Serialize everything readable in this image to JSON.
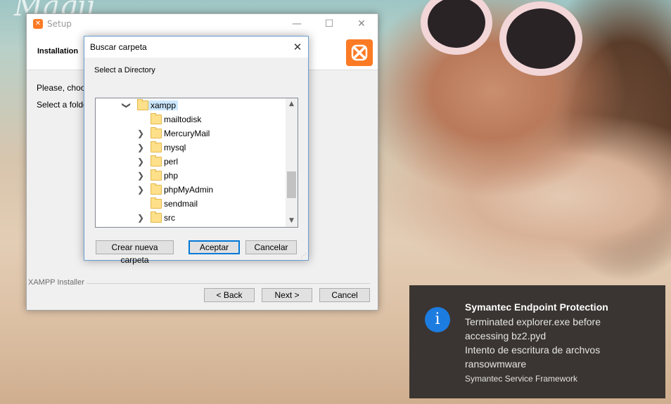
{
  "desktop": {
    "wallpaper_text": "Magii"
  },
  "setup": {
    "title": "Setup",
    "header_title": "Installation",
    "line1": "Please, choose",
    "line2": "Select a folder",
    "installer_label": "XAMPP Installer",
    "back_label": "< Back",
    "next_label": "Next >",
    "cancel_label": "Cancel",
    "controls": {
      "minimize": "—",
      "maximize": "☐",
      "close": "✕"
    }
  },
  "browse": {
    "title": "Buscar carpeta",
    "close": "✕",
    "prompt": "Select a Directory",
    "tree": [
      {
        "label": "xampp",
        "expanded": true,
        "selected": true
      },
      {
        "label": "mailtodisk",
        "has_children": false
      },
      {
        "label": "MercuryMail",
        "has_children": true
      },
      {
        "label": "mysql",
        "has_children": true
      },
      {
        "label": "perl",
        "has_children": true
      },
      {
        "label": "php",
        "has_children": true
      },
      {
        "label": "phpMyAdmin",
        "has_children": true
      },
      {
        "label": "sendmail",
        "has_children": false
      },
      {
        "label": "src",
        "has_children": true
      }
    ],
    "new_folder_label": "Crear nueva carpeta",
    "ok_label": "Aceptar",
    "cancel_label": "Cancelar"
  },
  "toast": {
    "title": "Symantec Endpoint Protection",
    "line1": "Terminated explorer.exe before",
    "line2": "accessing bz2.pyd",
    "line3": "Intento de escritura de archvos",
    "line4": "ransowmware",
    "source": "Symantec Service Framework",
    "icon": "info-icon",
    "icon_color": "#1d7ce0"
  },
  "colors": {
    "xampp_orange": "#fb7a24",
    "selection": "#cce8ff",
    "toast_bg": "#3a3532"
  }
}
